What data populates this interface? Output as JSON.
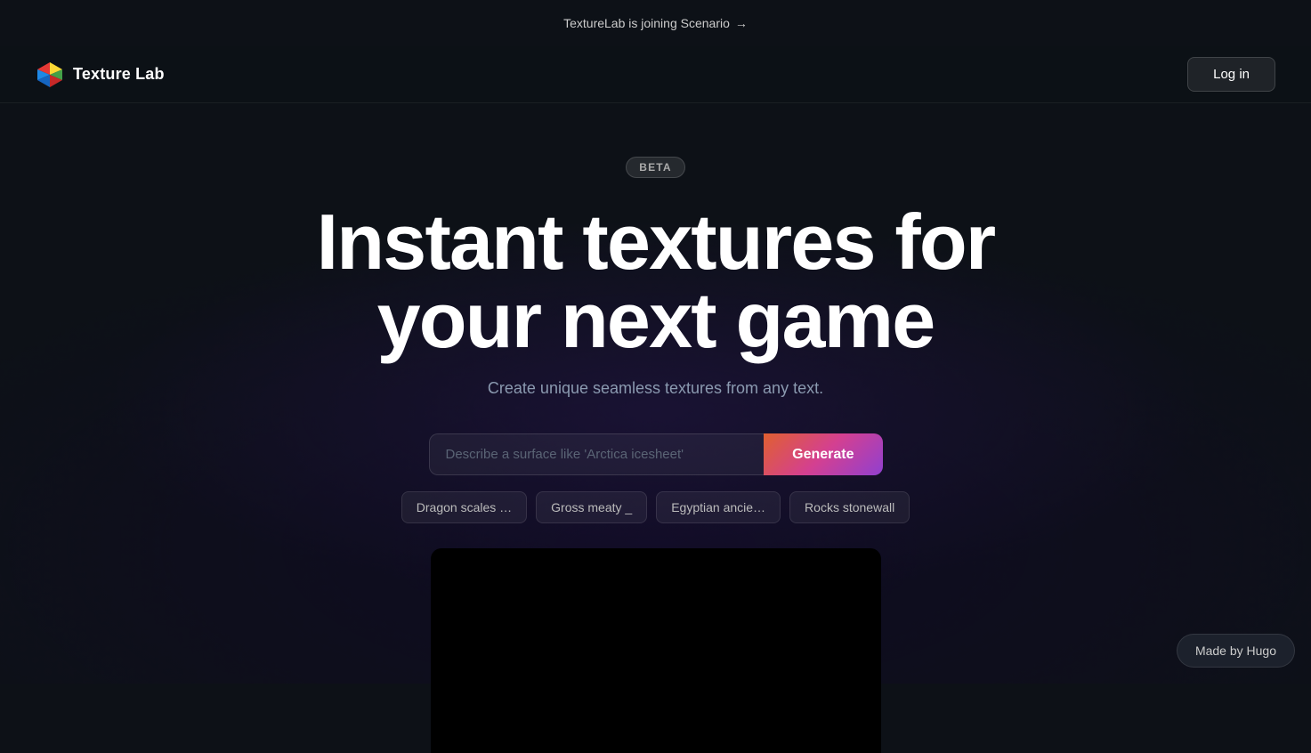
{
  "announcement": {
    "text": "TextureLab is joining Scenario",
    "arrow": "→"
  },
  "navbar": {
    "logo_alt": "Texture Lab logo",
    "title": "Texture Lab",
    "login_label": "Log in"
  },
  "hero": {
    "beta_label": "BETA",
    "heading_line1": "Instant textures for",
    "heading_line2": "your next game",
    "subtitle": "Create unique seamless textures from any text.",
    "input_placeholder": "Describe a surface like 'Arctica icesheet'",
    "generate_label": "Generate"
  },
  "chips": [
    {
      "id": "chip1",
      "label": "Dragon scales …"
    },
    {
      "id": "chip2",
      "label": "Gross meaty _"
    },
    {
      "id": "chip3",
      "label": "Egyptian ancie…"
    },
    {
      "id": "chip4",
      "label": "Rocks stonewall"
    }
  ],
  "footer": {
    "made_by": "Made by Hugo"
  }
}
